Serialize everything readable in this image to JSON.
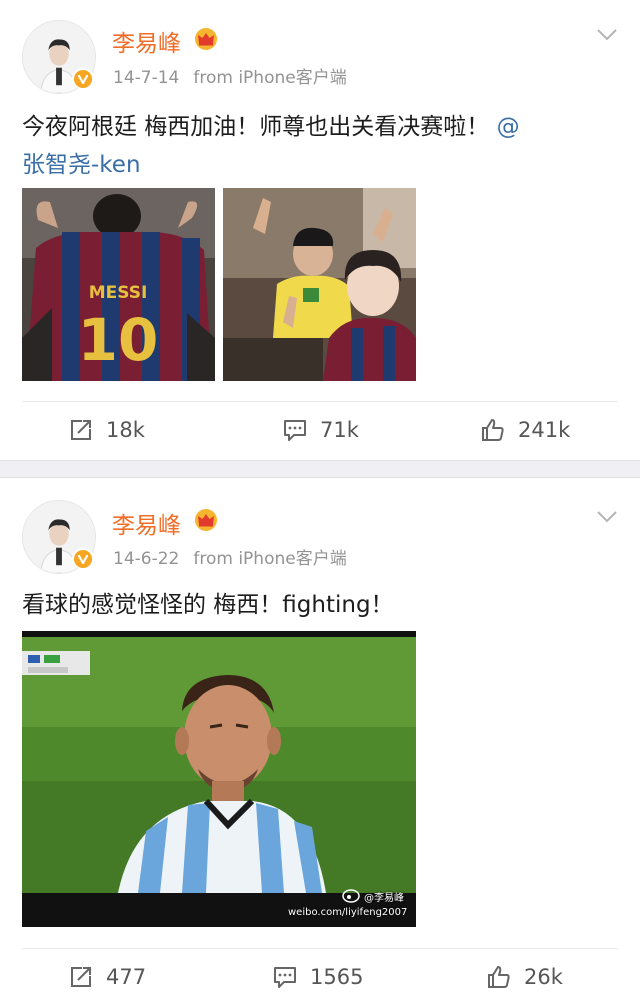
{
  "posts": [
    {
      "username": "李易峰",
      "date": "14-7-14",
      "source": "from iPhone客户端",
      "text_line1": "今夜阿根廷 梅西加油！师尊也出关看决赛啦！",
      "mention_at": "@",
      "mention_name": "张智尧-ken",
      "jersey_name": "MESSI",
      "jersey_number": "10",
      "reposts": "18k",
      "comments": "71k",
      "likes": "241k"
    },
    {
      "username": "李易峰",
      "date": "14-6-22",
      "source": "from iPhone客户端",
      "text": "看球的感觉怪怪的 梅西！fighting！",
      "watermark_user": "@李易峰",
      "watermark_url": "weibo.com/liyifeng2007",
      "reposts": "477",
      "comments": "1565",
      "likes": "26k"
    }
  ],
  "colors": {
    "username": "#f26d28",
    "meta": "#939393",
    "mention": "#3a6ea5",
    "verified_badge": "#f6a623",
    "separator": "#efeff4"
  },
  "icons": {
    "verified": "verified-badge-icon",
    "vip": "crown-icon",
    "menu": "chevron-down-icon",
    "repost": "repost-icon",
    "comment": "comment-icon",
    "like": "thumbs-up-icon"
  }
}
